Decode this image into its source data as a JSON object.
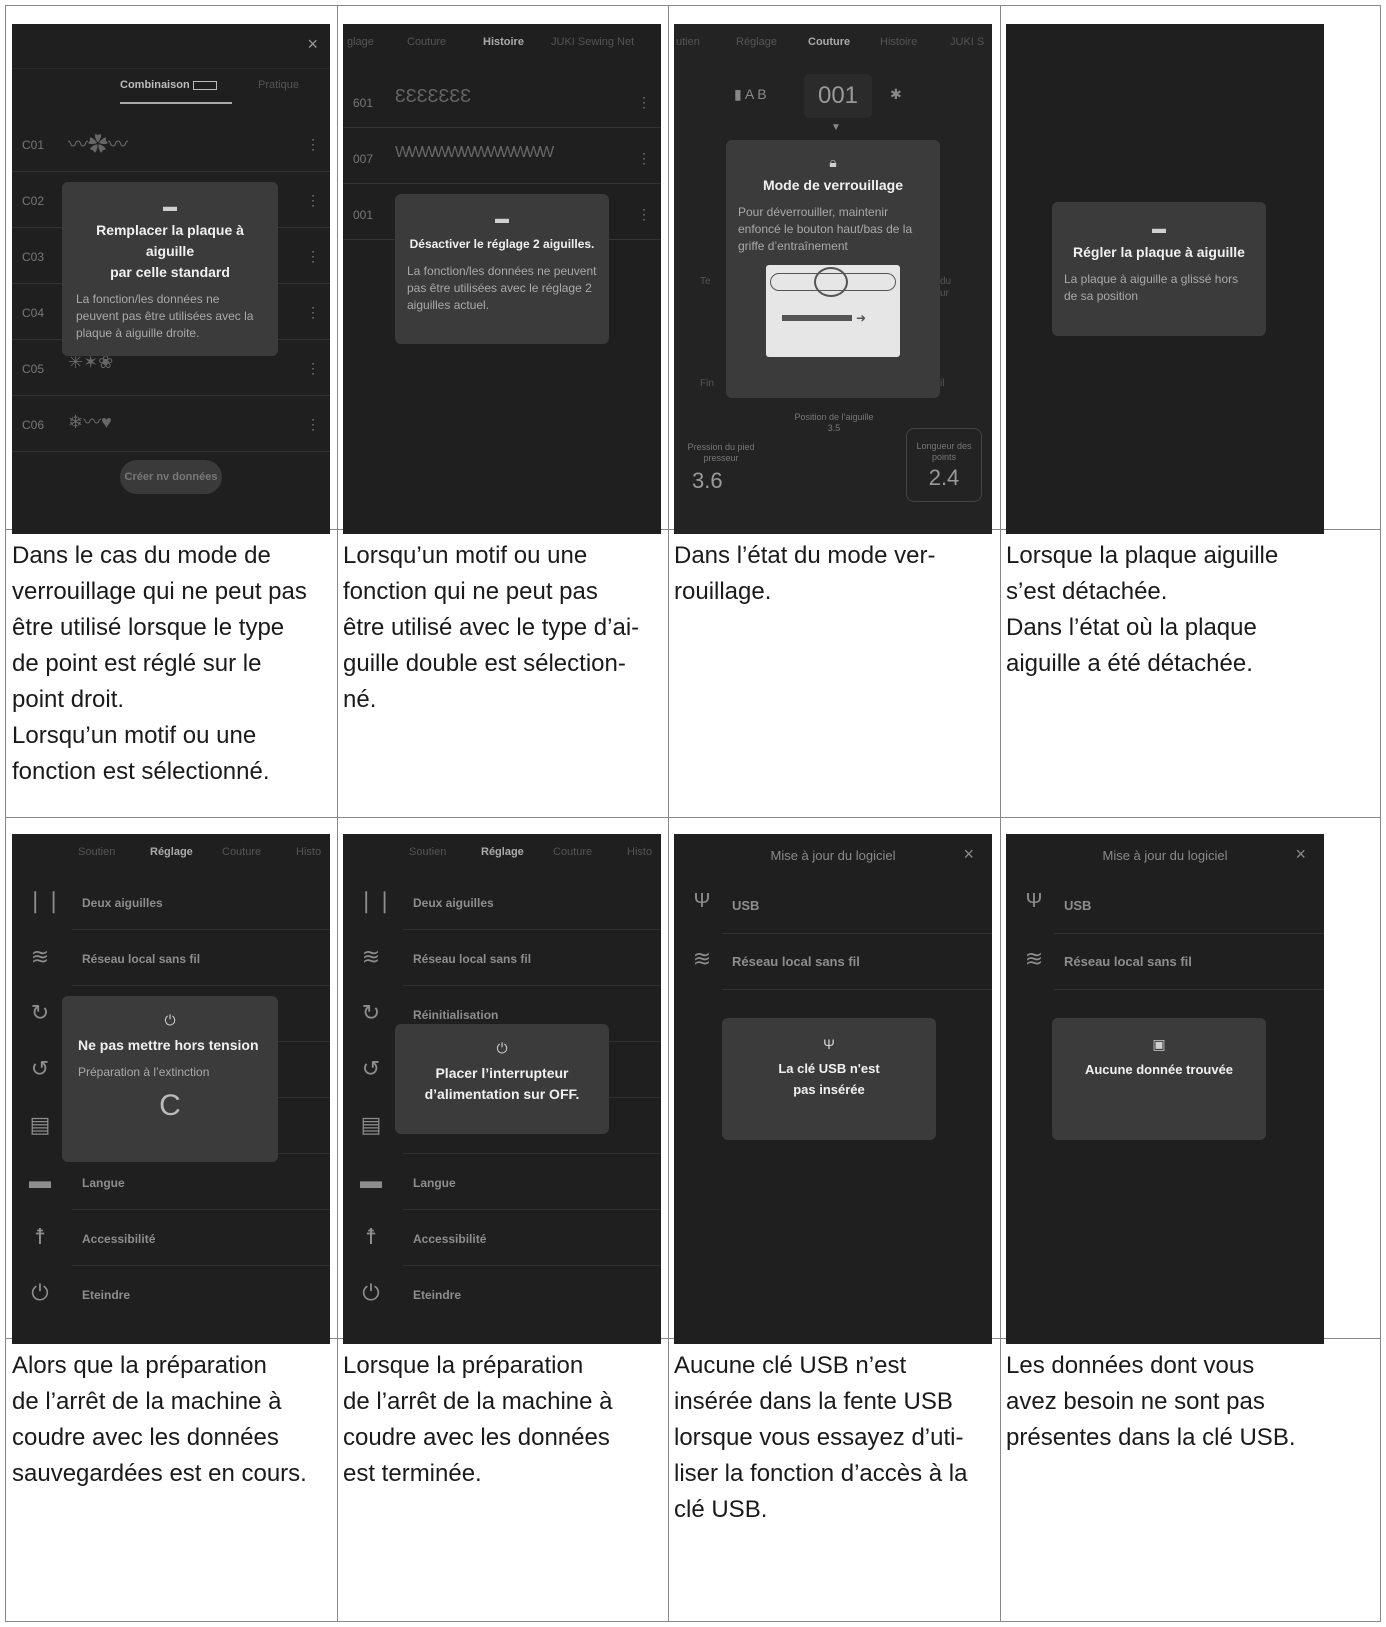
{
  "cells": [
    {
      "caption": [
        "Dans le cas du mode de",
        "verrouillage qui ne peut pas",
        "être utilisé lorsque le type",
        "de point est réglé sur le",
        "point droit.",
        "Lorsqu’un motif ou une",
        "fonction est sélectionné."
      ]
    },
    {
      "caption": [
        "Lorsqu’un motif ou une",
        "fonction qui ne peut pas",
        "être utilisé avec le type d’ai-",
        "guille double est sélection-",
        "né."
      ]
    },
    {
      "caption": [
        "Dans l’état du mode ver-",
        "rouillage."
      ]
    },
    {
      "caption": [
        "Lorsque la plaque aiguille",
        "s’est détachée.",
        "Dans l’état où la plaque",
        "aiguille a été détachée."
      ]
    },
    {
      "caption": [
        "Alors que la préparation",
        "de l’arrêt de la machine à",
        "coudre avec les données",
        "sauvegardées est en cours."
      ]
    },
    {
      "caption": [
        "Lorsque la préparation",
        "de l’arrêt de la machine à",
        "coudre avec les données",
        "est terminée."
      ]
    },
    {
      "caption": [
        "Aucune clé USB n’est",
        "insérée dans la fente USB",
        "lorsque vous essayez d’uti-",
        "liser la fonction d’accès à la",
        "clé USB."
      ]
    },
    {
      "caption": [
        "Les données dont vous",
        "avez besoin ne sont pas",
        "présentes dans la clé USB."
      ]
    }
  ],
  "s1": {
    "close": "×",
    "tab_active": "Combinaison",
    "tab_other": "Pratique",
    "codes": [
      "C01",
      "C02",
      "C03",
      "C04",
      "C05",
      "C06"
    ],
    "create": "Créer nv données",
    "dialog_title_1": "Remplacer la plaque à aiguille",
    "dialog_title_2": "par celle standard",
    "dialog_msg": "La fonction/les données ne peuvent pas être utilisées avec la plaque à aiguille droite."
  },
  "s2": {
    "tabs": [
      "glage",
      "Couture",
      "Histoire",
      "JUKI Sewing Net"
    ],
    "codes": [
      "601",
      "007",
      "001"
    ],
    "dialog_title": "Désactiver le réglage 2 aiguilles.",
    "dialog_msg": "La fonction/les données ne peuvent pas être utilisées avec le réglage 2 aiguilles actuel."
  },
  "s3": {
    "tabs": [
      "utien",
      "Réglage",
      "Couture",
      "Histoire",
      "JUKI S"
    ],
    "ab": "A B",
    "num": "001",
    "dialog_title": "Mode de verrouillage",
    "dialog_msg": "Pour déverrouiller, maintenir enfoncé le bouton haut/bas de la griffe d’entraînement",
    "pos_label": "Position de l’aiguille",
    "pos_val": "3.5",
    "press_label": "Pression du pied presseur",
    "press_val": "3.6",
    "len_label": "Longueur des points",
    "len_val": "2.4",
    "side_t": "Te",
    "side_fi": "Fin",
    "side_du": "du",
    "side_ur": "ur",
    "side_il": "il"
  },
  "s4": {
    "dialog_title": "Régler la plaque à aiguille",
    "dialog_msg": "La plaque à aiguille a glissé hors de sa position"
  },
  "menu": {
    "tabs": [
      "Soutien",
      "Réglage",
      "Couture",
      "Histo"
    ],
    "items": [
      "Deux aiguilles",
      "Réseau local sans fil",
      "Réinitialisation",
      "",
      "",
      "Langue",
      "Accessibilité",
      "Eteindre"
    ]
  },
  "s5": {
    "dialog_title": "Ne pas mettre hors tension",
    "dialog_msg": "Préparation à l’extinction"
  },
  "s6": {
    "dialog_title_1": "Placer l’interrupteur",
    "dialog_title_2": "d’alimentation sur OFF."
  },
  "usb": {
    "title": "Mise à jour du logiciel",
    "close": "×",
    "items": [
      "USB",
      "Réseau local sans fil"
    ]
  },
  "s7": {
    "dialog_title_1": "La clé USB n'est",
    "dialog_title_2": "pas insérée"
  },
  "s8": {
    "dialog_title": "Aucune donnée trouvée"
  }
}
